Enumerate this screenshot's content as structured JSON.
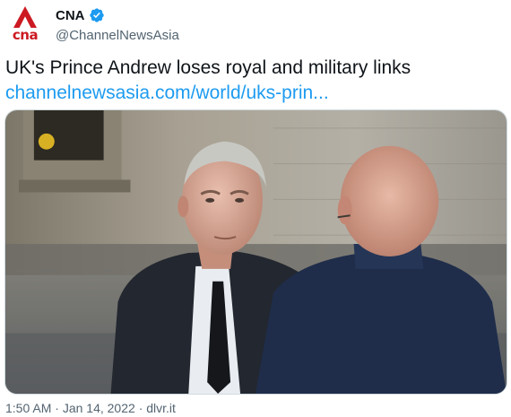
{
  "account": {
    "display_name": "CNA",
    "handle": "@ChannelNewsAsia",
    "avatar_wordmark": "cna",
    "avatar_icon": "cna-logo-icon",
    "verified_icon": "verified-badge-icon",
    "brand_color": "#cc1a22",
    "verified_color": "#1d9bf0"
  },
  "tweet": {
    "text": "UK's Prince Andrew loses royal and military links",
    "link": "channelnewsasia.com/world/uks-prin...",
    "link_color": "#1d9bf0"
  },
  "media": {
    "type": "photo"
  },
  "meta": {
    "time": "1:50 AM",
    "separator": "·",
    "date": "Jan 14, 2022",
    "source": "dlvr.it",
    "line": "1:50 AM · Jan 14, 2022 · dlvr.it"
  }
}
